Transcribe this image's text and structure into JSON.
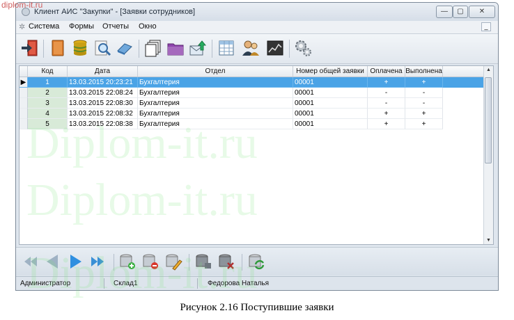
{
  "watermark_top": "diplom-it.ru",
  "watermark_big": "Diplom-it.ru",
  "window": {
    "title": "Клиент АИС \"Закупки\" - [Заявки сотрудников]",
    "controls": {
      "minimize": "—",
      "maximize": "▢",
      "close": "✕"
    }
  },
  "menu": {
    "items": [
      "Система",
      "Формы",
      "Отчеты",
      "Окно"
    ],
    "mdi_minimize": "_"
  },
  "toolbar": {
    "buttons": [
      "exit-icon",
      "book-icon",
      "database-icon",
      "search-icon",
      "eraser-icon",
      "windows-icon",
      "folder-icon",
      "export-icon",
      "table-icon",
      "users-icon",
      "chart-icon",
      "settings-icon"
    ]
  },
  "grid": {
    "columns": [
      "Код",
      "Дата",
      "Отдел",
      "Номер общей заявки",
      "Оплачена",
      "Выполнена"
    ],
    "rows": [
      {
        "code": "1",
        "date": "13.03.2015 20:23:21",
        "dept": "Бухгалтерия",
        "number": "00001",
        "paid": "+",
        "done": "+"
      },
      {
        "code": "2",
        "date": "13.03.2015 22:08:24",
        "dept": "Бухгалтерия",
        "number": "00001",
        "paid": "-",
        "done": "-"
      },
      {
        "code": "3",
        "date": "13.03.2015 22:08:30",
        "dept": "Бухгалтерия",
        "number": "00001",
        "paid": "-",
        "done": "-"
      },
      {
        "code": "4",
        "date": "13.03.2015 22:08:32",
        "dept": "Бухгалтерия",
        "number": "00001",
        "paid": "+",
        "done": "+"
      },
      {
        "code": "5",
        "date": "13.03.2015 22:08:38",
        "dept": "Бухгалтерия",
        "number": "00001",
        "paid": "+",
        "done": "+"
      }
    ],
    "selected_row": 1,
    "row_indicator": "▶",
    "scroll_up": "▲",
    "scroll_down": "▼"
  },
  "navigator": {
    "buttons": [
      "first-icon",
      "prior-icon",
      "next-icon",
      "last-icon",
      "insert-icon",
      "delete-icon",
      "edit-icon",
      "post-icon",
      "cancel-icon",
      "refresh-icon"
    ]
  },
  "status": {
    "user": "Администратор",
    "warehouse": "Склад1",
    "name": "Федорова Наталья"
  },
  "caption": "Рисунок 2.16 Поступившие заявки",
  "colors": {
    "selection": "#4aa3e6",
    "code_column": "#d8ead8",
    "watermark": "#78e678"
  }
}
